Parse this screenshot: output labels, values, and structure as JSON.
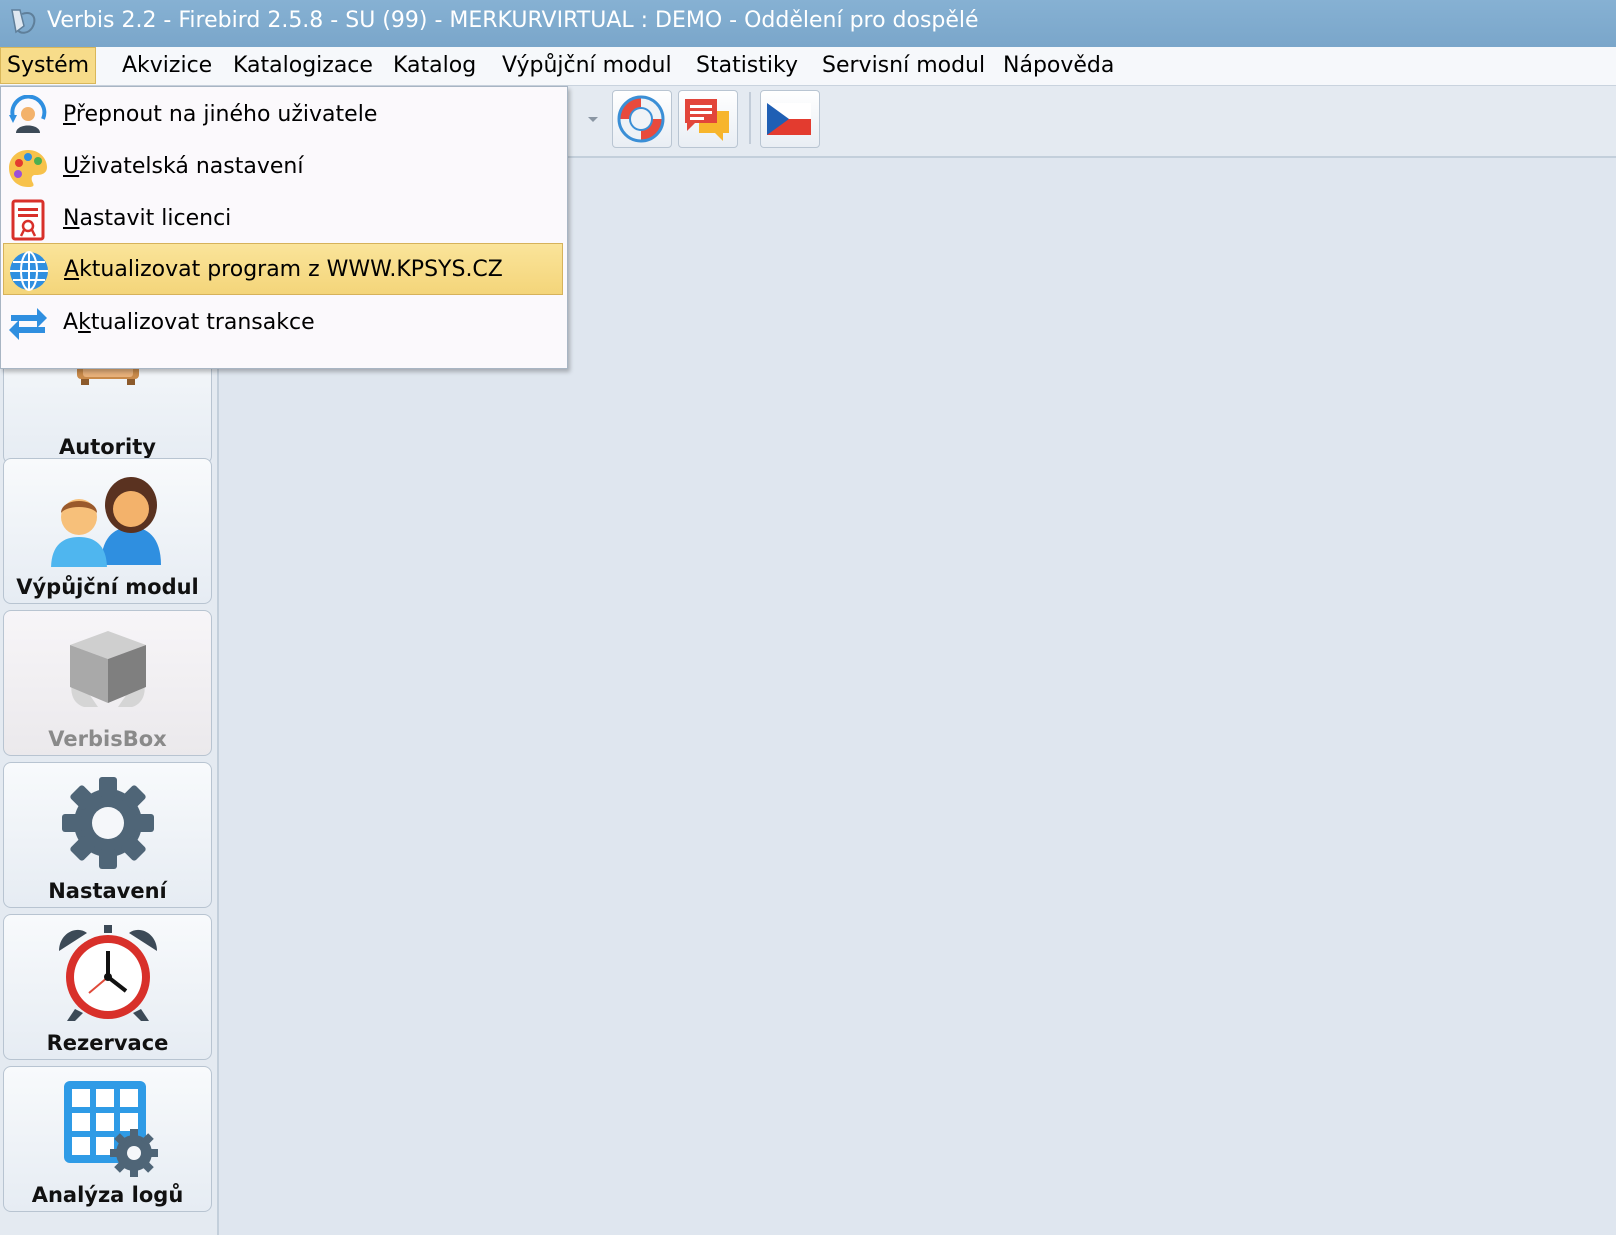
{
  "window": {
    "title": "Verbis 2.2 - Firebird 2.5.8 - SU (99) - MERKURVIRTUAL : DEMO - Oddělení pro dospělé"
  },
  "menubar": {
    "items": [
      {
        "label": "Systém",
        "active": true
      },
      {
        "label": "Akvizice"
      },
      {
        "label": "Katalogizace"
      },
      {
        "label": "Katalog"
      },
      {
        "label": "Výpůjční modul"
      },
      {
        "label": "Statistiky"
      },
      {
        "label": "Servisní modul"
      },
      {
        "label": "Nápověda"
      }
    ]
  },
  "system_menu": {
    "items": [
      {
        "accel": "P",
        "rest": "řepnout na jiného uživatele",
        "icon": "switch-user-icon"
      },
      {
        "accel": "U",
        "rest": "živatelská nastavení",
        "icon": "palette-icon"
      },
      {
        "accel": "N",
        "rest": "astavit licenci",
        "icon": "license-icon"
      },
      {
        "accel": "A",
        "rest": "ktualizovat program z WWW.KPSYS.CZ",
        "icon": "globe-icon",
        "highlighted": true
      },
      {
        "pre": "A",
        "accel": "k",
        "rest": "tualizovat transakce",
        "icon": "sync-icon"
      }
    ]
  },
  "toolbar": {
    "buttons": [
      {
        "icon": "lifebuoy-icon"
      },
      {
        "icon": "chat-icon"
      },
      {
        "icon": "czech-flag-icon"
      }
    ]
  },
  "sidebar": {
    "modules": [
      {
        "label": "Autority",
        "icon": "cabinet-icon"
      },
      {
        "label": "Výpůjční modul",
        "icon": "people-icon"
      },
      {
        "label": "VerbisBox",
        "icon": "box-icon",
        "disabled": true
      },
      {
        "label": "Nastavení",
        "icon": "gear-icon"
      },
      {
        "label": "Rezervace",
        "icon": "alarm-clock-icon"
      },
      {
        "label": "Analýza logů",
        "icon": "grid-gear-icon"
      }
    ]
  },
  "colors": {
    "titlebar": "#7aa6ca",
    "menu_active": "#f7dc8a",
    "background": "#dfe6ef"
  }
}
